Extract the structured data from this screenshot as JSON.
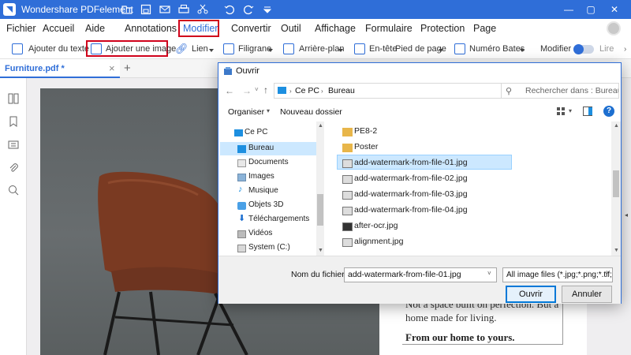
{
  "app": {
    "title": "Wondershare PDFelement",
    "quick_access": [
      "new-folder-icon",
      "save-icon",
      "mail-icon",
      "print-icon",
      "scissors-icon",
      "undo-icon",
      "redo-icon",
      "dropdown-icon"
    ],
    "window_buttons": {
      "minimize": "—",
      "maximize": "▢",
      "close": "✕"
    }
  },
  "menu": {
    "items": [
      "Fichier",
      "Accueil",
      "Aide",
      "Annotations",
      "Modifier",
      "Convertir",
      "Outil",
      "Affichage",
      "Formulaire",
      "Protection",
      "Page"
    ],
    "active": "Modifier"
  },
  "toolbar": {
    "add_text": "Ajouter du texte",
    "add_image": "Ajouter une image",
    "link": "Lien",
    "watermark": "Filigrane",
    "background": "Arrière-plan",
    "header_footer_a": "En-tête",
    "header_footer_b": "Pied de page",
    "bates": "Numéro Bates",
    "modify": "Modifier",
    "read": "Lire"
  },
  "tabs": {
    "doc_tab": "Furniture.pdf *",
    "close": "×",
    "add": "+"
  },
  "sidebar_icons": [
    "thumbnails-icon",
    "bookmark-icon",
    "comment-icon",
    "attachment-icon",
    "search-icon"
  ],
  "document": {
    "text_lines": [
      "Not a space built on perfection. But a",
      "home made for living."
    ],
    "tagline": "From our home to yours."
  },
  "dialog": {
    "title": "Ouvrir",
    "path": [
      "Ce PC",
      "Bureau"
    ],
    "search_placeholder": "Rechercher dans : Bureau",
    "organize": "Organiser",
    "new_folder": "Nouveau dossier",
    "nav": [
      "Ce PC",
      "Bureau",
      "Documents",
      "Images",
      "Musique",
      "Objets 3D",
      "Téléchargements",
      "Vidéos",
      "System (C:)"
    ],
    "nav_selected": "Bureau",
    "files": [
      {
        "name": "PE8-2",
        "type": "folder"
      },
      {
        "name": "Poster",
        "type": "folder"
      },
      {
        "name": "add-watermark-from-file-01.jpg",
        "type": "image"
      },
      {
        "name": "add-watermark-from-file-02.jpg",
        "type": "image"
      },
      {
        "name": "add-watermark-from-file-03.jpg",
        "type": "image"
      },
      {
        "name": "add-watermark-from-file-04.jpg",
        "type": "image"
      },
      {
        "name": "after-ocr.jpg",
        "type": "image"
      },
      {
        "name": "alignment.jpg",
        "type": "image"
      }
    ],
    "selected_file": "add-watermark-from-file-01.jpg",
    "filename_label": "Nom du fichier :",
    "filename_value": "add-watermark-from-file-01.jpg",
    "filter_value": "All image files (*.jpg;*.png;*.tif;*",
    "open_button": "Ouvrir",
    "cancel_button": "Annuler"
  },
  "colors": {
    "accent": "#2f6ed8",
    "highlight": "#d0021b",
    "selection": "#cce8ff"
  }
}
